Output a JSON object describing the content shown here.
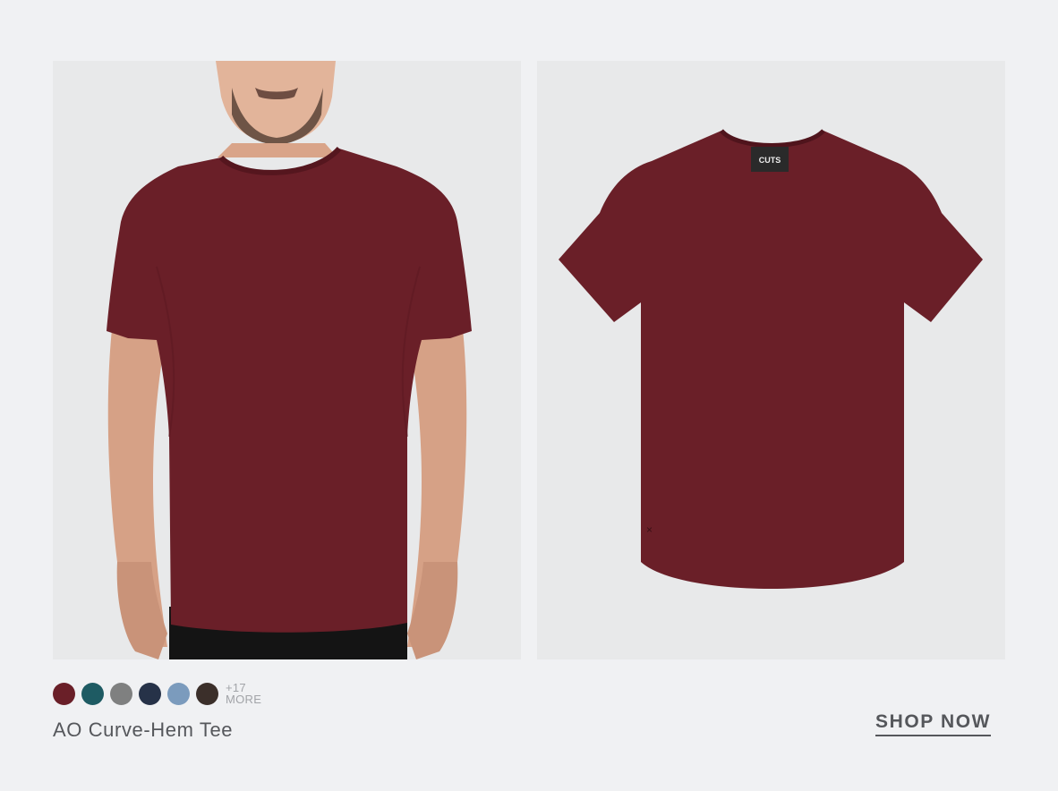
{
  "product": {
    "name": "AO Curve-Hem Tee",
    "color_accent": "#6a1f28"
  },
  "images": {
    "model_alt": "Model wearing burgundy curve-hem tee",
    "flat_alt": "Burgundy curve-hem tee flat lay",
    "tag_text": "CUTS"
  },
  "swatches": [
    {
      "color": "#6a1f28"
    },
    {
      "color": "#1e5b63"
    },
    {
      "color": "#7f8080"
    },
    {
      "color": "#263248"
    },
    {
      "color": "#7b9bbd"
    },
    {
      "color": "#3b2f2a"
    }
  ],
  "more": {
    "count": "+17",
    "label": "MORE"
  },
  "cta": {
    "label": "SHOP NOW"
  }
}
